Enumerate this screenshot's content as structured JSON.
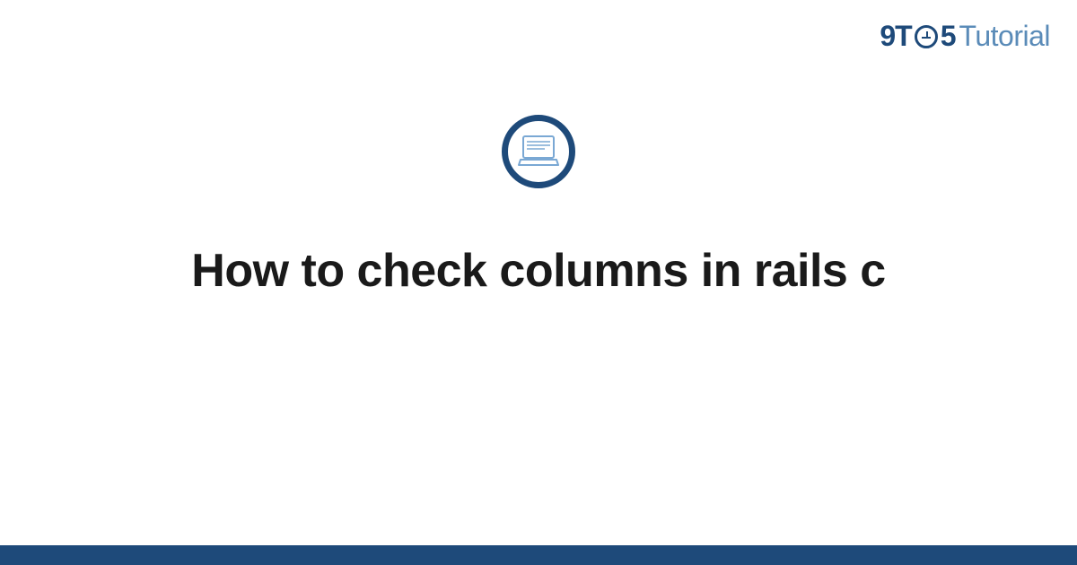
{
  "logo": {
    "part1": "9T",
    "part2": "5",
    "part3": "Tutorial"
  },
  "title": "How to check columns in rails c",
  "colors": {
    "brand_dark": "#1e4a7a",
    "brand_light": "#5a8bb8",
    "icon_stroke": "#7aa8d4"
  },
  "icon": {
    "name": "laptop-icon"
  }
}
